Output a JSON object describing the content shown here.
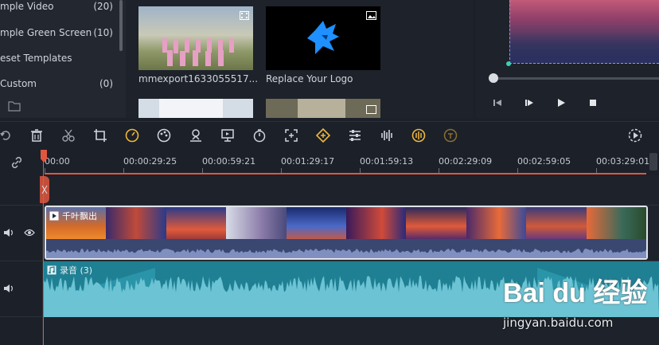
{
  "sidebar": {
    "items": [
      {
        "label": "mple Video",
        "count": "(20)"
      },
      {
        "label": "mple Green Screen",
        "count": "(10)"
      },
      {
        "label": "eset Templates",
        "count": ""
      },
      {
        "label": "Custom",
        "count": "(0)"
      }
    ]
  },
  "media": {
    "items": [
      {
        "label": "mmexport1633055517...",
        "badge": "video-icon"
      },
      {
        "label": "Replace Your Logo",
        "badge": "image-icon"
      },
      {
        "label": "",
        "badge": ""
      },
      {
        "label": "",
        "badge": "image-icon"
      }
    ]
  },
  "toolbar": {
    "tools": [
      "undo-icon",
      "delete-icon",
      "cut-icon",
      "crop-icon",
      "speed-icon",
      "color-icon",
      "green-screen-icon",
      "motion-icon",
      "duration-icon",
      "fit-icon",
      "keyframe-icon",
      "adjust-icon",
      "audio-mixer-icon",
      "voiceover-icon",
      "speech-icon",
      "render-icon"
    ]
  },
  "ruler": {
    "ticks": [
      "00:00",
      "00:00:29:25",
      "00:00:59:21",
      "00:01:29:17",
      "00:01:59:13",
      "00:02:29:09",
      "00:02:59:05",
      "00:03:29:01"
    ]
  },
  "timeline": {
    "video_clip_title": "千叶飘出",
    "audio_clip_title": "录音 (3)"
  },
  "watermark": {
    "logo": "Bai du 经验",
    "url": "jingyan.baidu.com"
  },
  "colors": {
    "accent": "#e0573f",
    "audio": "#1f7f93",
    "selected": "#f0b73a"
  }
}
